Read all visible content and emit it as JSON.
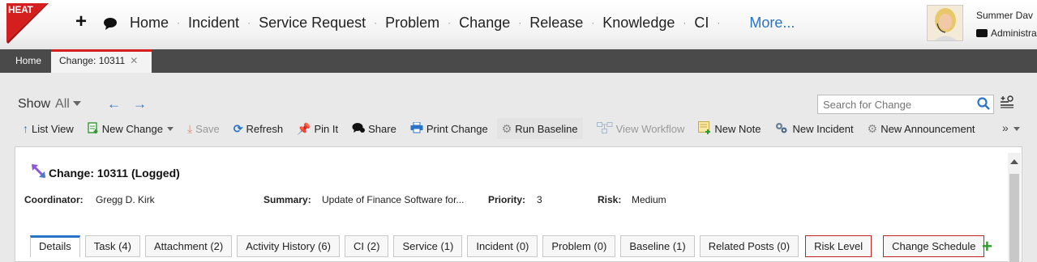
{
  "app": {
    "logo_text": "HEAT"
  },
  "nav": {
    "items": [
      "Home",
      "Incident",
      "Service Request",
      "Problem",
      "Change",
      "Release",
      "Knowledge",
      "CI"
    ],
    "more": "More..."
  },
  "user": {
    "name": "Summer Dav",
    "role": "Administra"
  },
  "tabs": {
    "home": "Home",
    "active": "Change: 10311"
  },
  "toolbar": {
    "show_label": "Show",
    "show_value": "All",
    "search_placeholder": "Search for Change",
    "actions": {
      "list_view": "List View",
      "new_change": "New Change",
      "save": "Save",
      "refresh": "Refresh",
      "pin_it": "Pin It",
      "share": "Share",
      "print_change": "Print Change",
      "run_baseline": "Run Baseline",
      "view_workflow": "View Workflow",
      "new_note": "New Note",
      "new_incident": "New Incident",
      "new_announcement": "New Announcement"
    },
    "more": "»"
  },
  "record": {
    "title": "Change: 10311 (Logged)",
    "fields": {
      "coordinator_label": "Coordinator:",
      "coordinator_value": "Gregg D. Kirk",
      "summary_label": "Summary:",
      "summary_value": "Update of Finance Software for...",
      "priority_label": "Priority:",
      "priority_value": "3",
      "risk_label": "Risk:",
      "risk_value": "Medium"
    },
    "tabs": [
      "Details",
      "Task (4)",
      "Attachment (2)",
      "Activity History (6)",
      "CI (2)",
      "Service (1)",
      "Incident (0)",
      "Problem (0)",
      "Baseline (1)",
      "Related Posts (0)",
      "Risk Level",
      "Change Schedule"
    ]
  },
  "colors": {
    "accent": "#2a74c6",
    "brand_red": "#d51f1f",
    "add_green": "#2c9a2c",
    "tabstrip": "#4a4a4a"
  }
}
